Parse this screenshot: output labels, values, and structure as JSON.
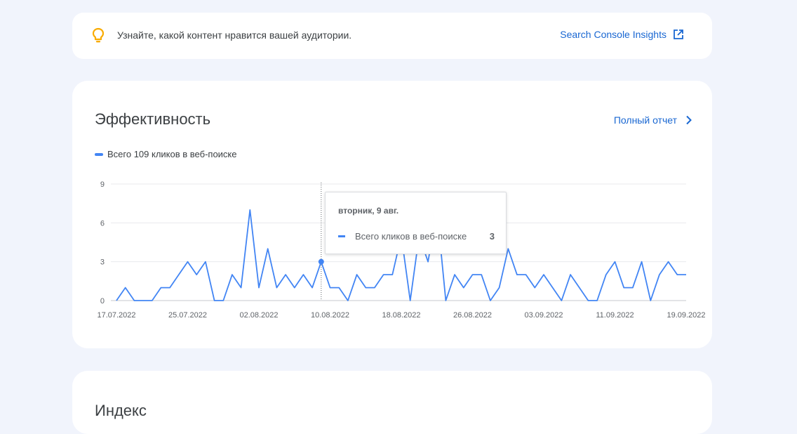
{
  "insights": {
    "text": "Узнайте, какой контент нравится вашей аудитории.",
    "link_label": "Search Console Insights",
    "icon": "lightbulb-icon",
    "link_icon": "open-in-new-icon"
  },
  "performance": {
    "title": "Эффективность",
    "full_report_label": "Полный отчет",
    "legend_label": "Всего 109 кликов в веб-поиске"
  },
  "tooltip": {
    "date": "вторник, 9 авг.",
    "series_label": "Всего кликов в веб-поиске",
    "value": "3"
  },
  "index": {
    "title": "Индекс"
  },
  "colors": {
    "accent": "#1967d2",
    "series": "#4285f4",
    "bulb": "#f9ab00"
  },
  "chart_data": {
    "type": "line",
    "y_ticks": [
      "0",
      "3",
      "6",
      "9"
    ],
    "ylim": [
      0,
      9
    ],
    "x_ticks": [
      "17.07.2022",
      "25.07.2022",
      "02.08.2022",
      "10.08.2022",
      "18.08.2022",
      "26.08.2022",
      "03.09.2022",
      "11.09.2022",
      "19.09.2022"
    ],
    "grid": true,
    "highlight_index": 23,
    "series": [
      {
        "name": "Всего кликов в веб-поиске",
        "values": [
          0,
          1,
          0,
          0,
          0,
          1,
          1,
          2,
          3,
          2,
          3,
          0,
          0,
          2,
          1,
          7,
          1,
          4,
          1,
          2,
          1,
          2,
          1,
          3,
          1,
          1,
          0,
          2,
          1,
          1,
          2,
          2,
          5,
          0,
          5,
          3,
          7,
          0,
          2,
          1,
          2,
          2,
          0,
          1,
          4,
          2,
          2,
          1,
          2,
          1,
          0,
          2,
          1,
          0,
          0,
          2,
          3,
          1,
          1,
          3,
          0,
          2,
          3,
          2,
          2
        ]
      }
    ]
  }
}
